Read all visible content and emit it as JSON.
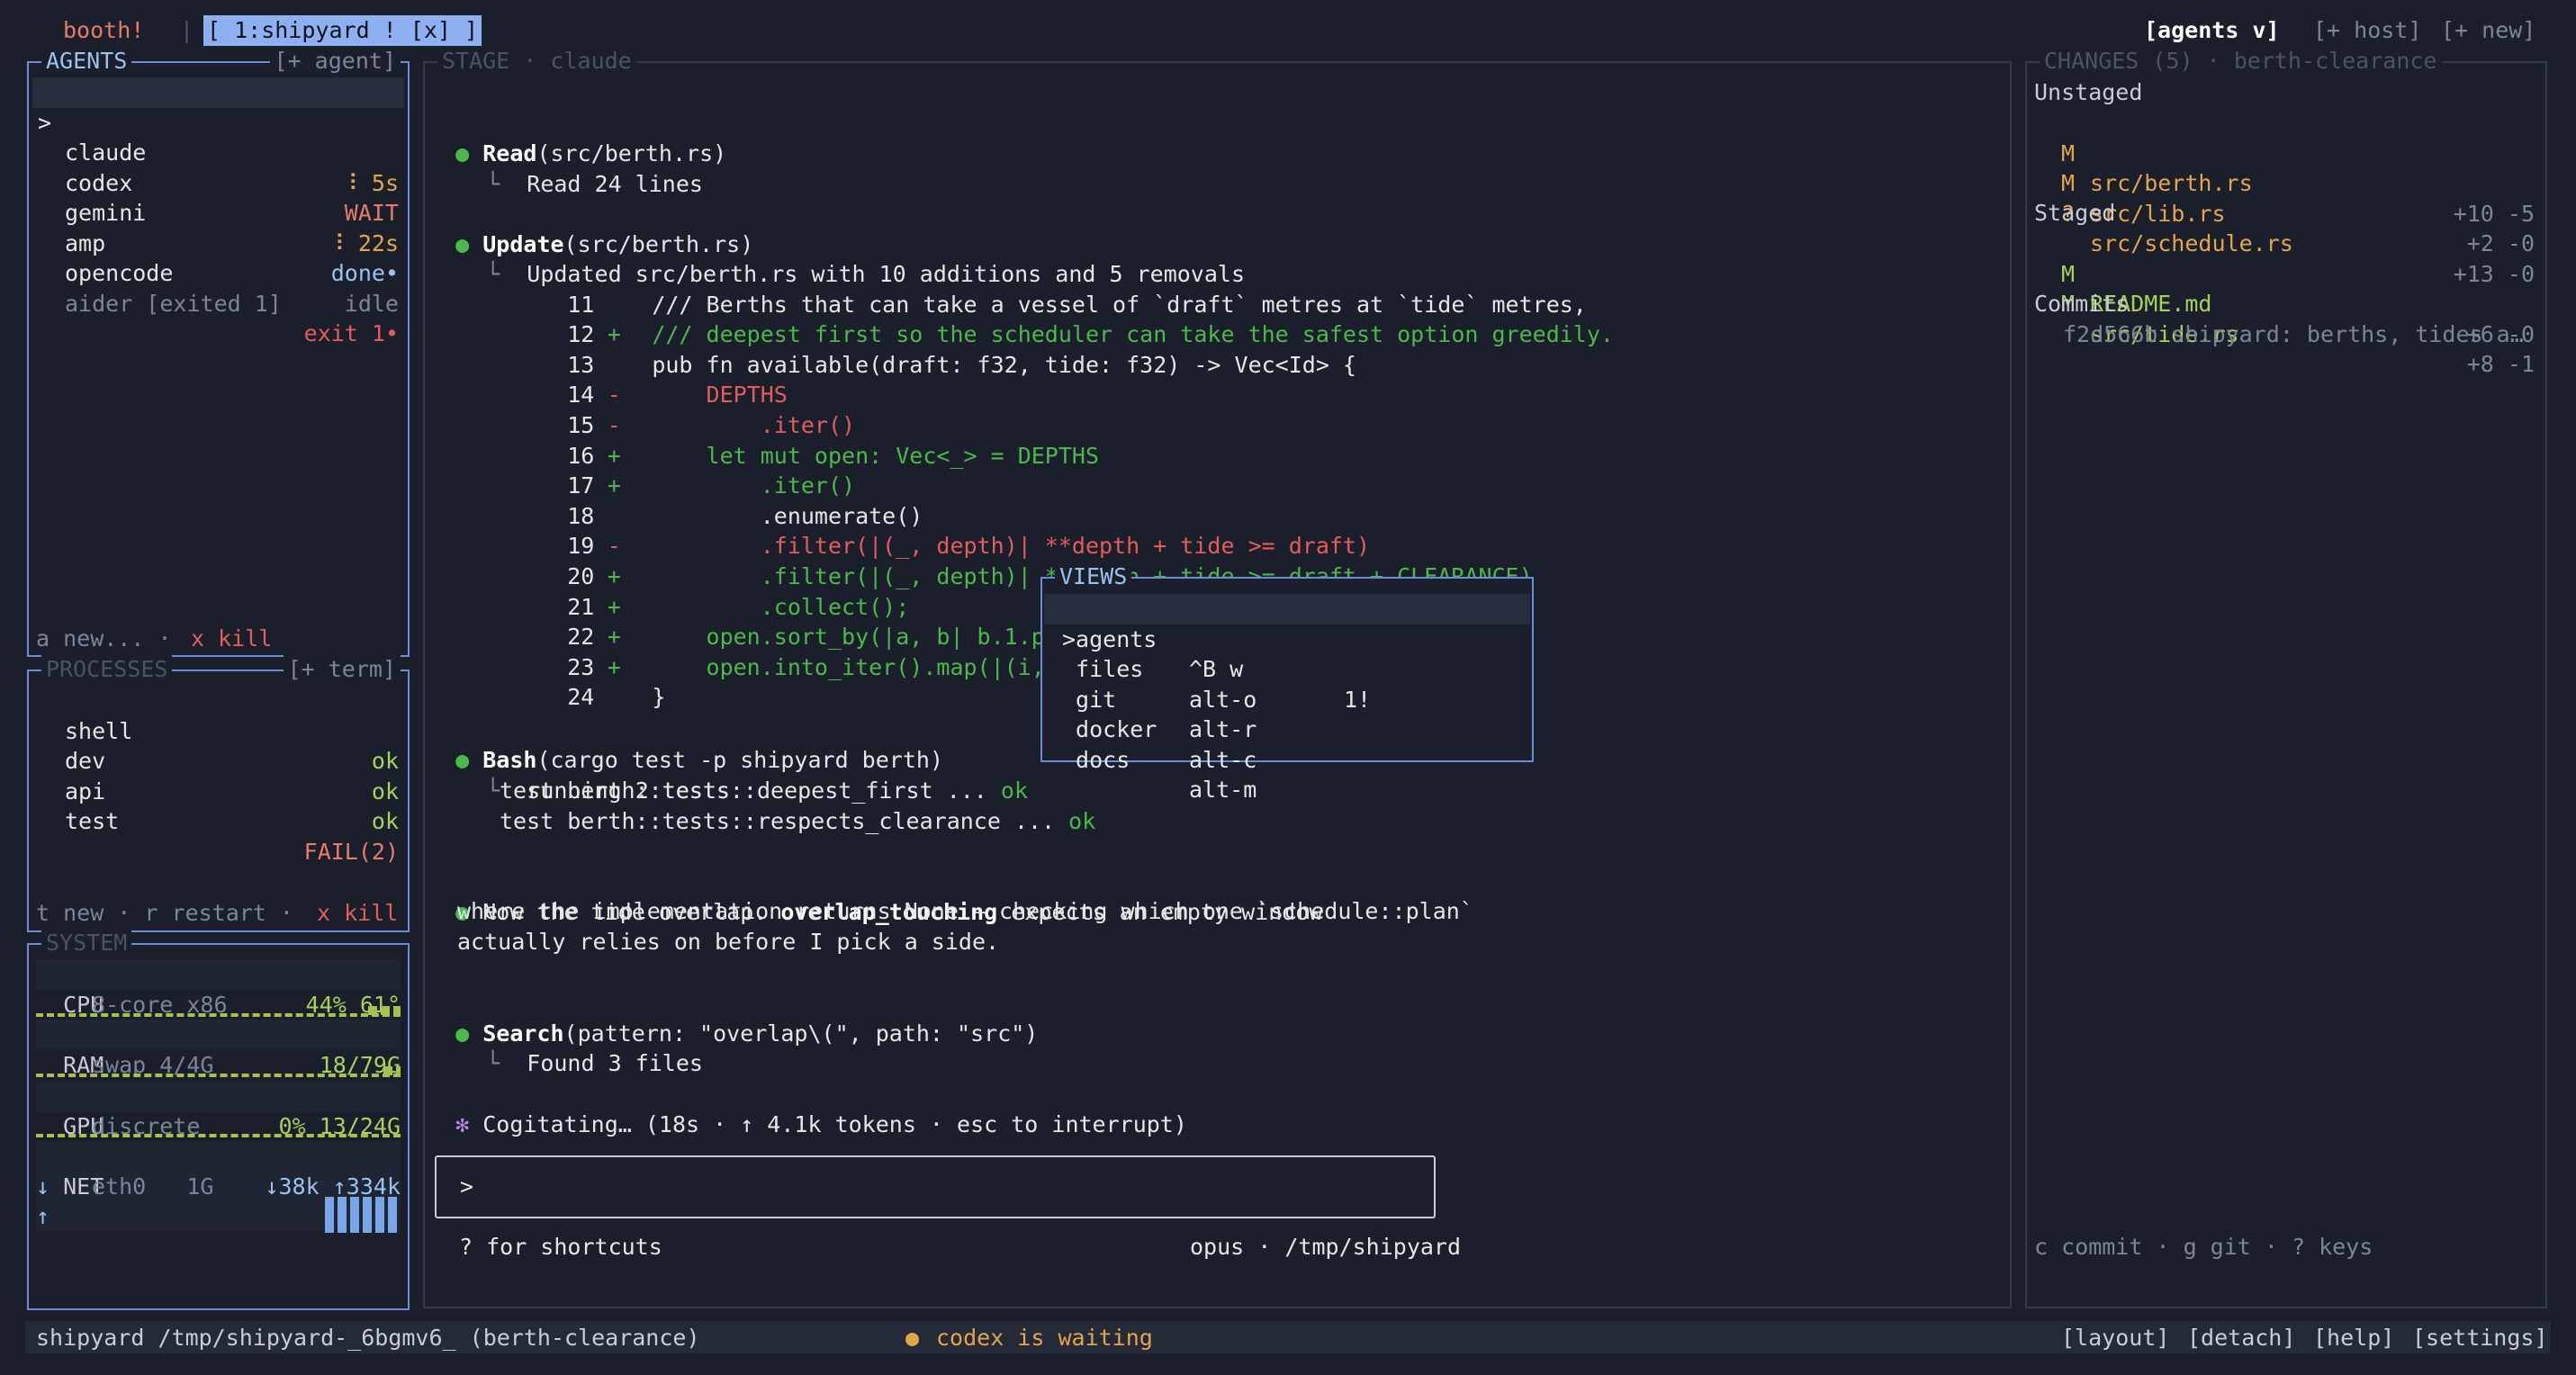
{
  "topbar": {
    "brand": "booth!",
    "sep": "|",
    "tab": "[ 1:shipyard ! [x] ]",
    "agents_menu": "[agents v]",
    "host": "[+ host]",
    "new": "[+ new]"
  },
  "agents": {
    "title": "AGENTS",
    "add": "[+ agent]",
    "items": [
      {
        "marker": ">",
        "name": "claude",
        "spin": "⠸",
        "status": "5s"
      },
      {
        "marker": "",
        "name": "codex",
        "spin": "",
        "status": "WAIT"
      },
      {
        "marker": "",
        "name": "gemini",
        "spin": "⠸",
        "status": "22s"
      },
      {
        "marker": "",
        "name": "amp",
        "spin": "",
        "status": "done•"
      },
      {
        "marker": "",
        "name": "opencode",
        "spin": "",
        "status": "idle"
      },
      {
        "marker": "",
        "name": "aider [exited 1]",
        "spin": "",
        "status": "exit 1•"
      }
    ],
    "footer_new": "a new... · ",
    "footer_kill": "x kill"
  },
  "processes": {
    "title": "PROCESSES",
    "add": "[+ term]",
    "items": [
      {
        "name": "shell",
        "status": "ok"
      },
      {
        "name": "dev",
        "status": "ok"
      },
      {
        "name": "api",
        "status": "ok"
      },
      {
        "name": "test",
        "status": "FAIL(2)"
      }
    ],
    "footer_new": "t new · r restart · ",
    "footer_kill": "x kill"
  },
  "system": {
    "title": "SYSTEM",
    "cpu": {
      "label": "CPU",
      "detail": "8-core x86",
      "value": "44% 61°",
      "level": 0.44
    },
    "ram": {
      "label": "RAM",
      "detail": "swap 4/4G",
      "value": "18/79G",
      "level": 0.23
    },
    "gpu": {
      "label": "GPU",
      "detail": "discrete",
      "value": "0% 13/24G",
      "level": 0.0
    },
    "net": {
      "label": "NET",
      "detail": "eth0   1G",
      "down": "↓38k",
      "up": "↑334k",
      "down_arrow": "↓",
      "up_arrow": "↑"
    }
  },
  "stage": {
    "title": "STAGE · claude",
    "read_tool": "Read",
    "read_arg": "(src/berth.rs)",
    "read_result": "Read 24 lines",
    "update_tool": "Update",
    "update_arg": "(src/berth.rs)",
    "update_result": "Updated src/berth.rs with 10 additions and 5 removals",
    "diff": [
      {
        "n": "11",
        "sign": " ",
        "kind": "ctx",
        "code": "/// Berths that can take a vessel of `draft` metres at `tide` metres,"
      },
      {
        "n": "12",
        "sign": "+",
        "kind": "add",
        "code": "/// deepest first so the scheduler can take the safest option greedily."
      },
      {
        "n": "13",
        "sign": " ",
        "kind": "ctx",
        "code": "pub fn available(draft: f32, tide: f32) -> Vec<Id> {"
      },
      {
        "n": "14",
        "sign": "-",
        "kind": "del",
        "code": "    DEPTHS"
      },
      {
        "n": "15",
        "sign": "-",
        "kind": "del",
        "code": "        .iter()"
      },
      {
        "n": "16",
        "sign": "+",
        "kind": "add",
        "code": "    let mut open: Vec<_> = DEPTHS"
      },
      {
        "n": "17",
        "sign": "+",
        "kind": "add",
        "code": "        .iter()"
      },
      {
        "n": "18",
        "sign": " ",
        "kind": "ctx",
        "code": "        .enumerate()"
      },
      {
        "n": "19",
        "sign": "-",
        "kind": "del",
        "code": "        .filter(|(_, depth)| **depth + tide >= draft)"
      },
      {
        "n": "20",
        "sign": "+",
        "kind": "add",
        "code": "        .filter(|(_, depth)| **depth + tide >= draft + CLEARANCE)"
      },
      {
        "n": "21",
        "sign": "+",
        "kind": "add",
        "code": "        .collect();"
      },
      {
        "n": "22",
        "sign": "+",
        "kind": "add",
        "code": "    open.sort_by(|a, b| b.1.parti"
      },
      {
        "n": "23",
        "sign": "+",
        "kind": "add",
        "code": "    open.into_iter().map(|(i, _)|"
      },
      {
        "n": "24",
        "sign": " ",
        "kind": "ctx",
        "code": "}"
      }
    ],
    "bash_tool": "Bash",
    "bash_arg": "(cargo test -p shipyard berth)",
    "bash_result": "running 2 tests",
    "test1": "test berth::tests::deepest_first ... ",
    "test1_ok": "ok",
    "test2": "test berth::tests::respects_clearance ... ",
    "test2_ok": "ok",
    "msg_pre": "Now the tide overlap. ",
    "msg_bold": "overlap_touching",
    "msg_post": " expects an empty window",
    "msg_line2": "where the implementation returns None — checking which one `schedule::plan`",
    "msg_line3": "actually relies on before I pick a side.",
    "search_tool": "Search",
    "search_arg": "(pattern: \"overlap\\(\", path: \"src\")",
    "search_result": "Found 3 files",
    "cogitating": "Cogitating… (18s · ↑ 4.1k tokens · esc to interrupt)",
    "prompt": ">",
    "shortcuts": "? for shortcuts",
    "model_path": "opus · /tmp/shipyard"
  },
  "views": {
    "title": "VIEWS",
    "items": [
      {
        "label": ">agents",
        "key": "^B w",
        "badge": "1!"
      },
      {
        "label": " files",
        "key": "alt-o",
        "badge": ""
      },
      {
        "label": " git",
        "key": "alt-r",
        "badge": ""
      },
      {
        "label": " docker",
        "key": "alt-c",
        "badge": ""
      },
      {
        "label": " docs",
        "key": "alt-m",
        "badge": ""
      }
    ]
  },
  "changes": {
    "title": "CHANGES (5) · berth-clearance",
    "unstaged_label": "Unstaged",
    "unstaged": [
      {
        "flag": "M",
        "file": "src/berth.rs",
        "stat": "+10 -5"
      },
      {
        "flag": "M",
        "file": "src/lib.rs",
        "stat": "+2 -0"
      },
      {
        "flag": "?",
        "file": "src/schedule.rs",
        "stat": "+13 -0"
      }
    ],
    "staged_label": "Staged",
    "staged": [
      {
        "flag": "M",
        "file": "README.md",
        "stat": "+6 -0"
      },
      {
        "flag": "M",
        "file": "src/tide.rs",
        "stat": "+8 -1"
      }
    ],
    "commits_label": "Commits",
    "commit": "f2d566b shipyard: berths, tides a…",
    "footer": "c commit · g git · ? keys"
  },
  "statusbar": {
    "left": "shipyard /tmp/shipyard-_6bgmv6_ (berth-clearance)",
    "dot": "●",
    "waiting": "codex is waiting",
    "layout": "[layout]",
    "detach": "[detach]",
    "help": "[help]",
    "settings": "[settings]"
  },
  "colors": {
    "bg": "#1a1f2b",
    "border": "#4a5d82",
    "accent_tab": "#8fb0f0",
    "green": "#4cb84c",
    "red": "#e25c5c",
    "orange": "#e3a54a"
  }
}
